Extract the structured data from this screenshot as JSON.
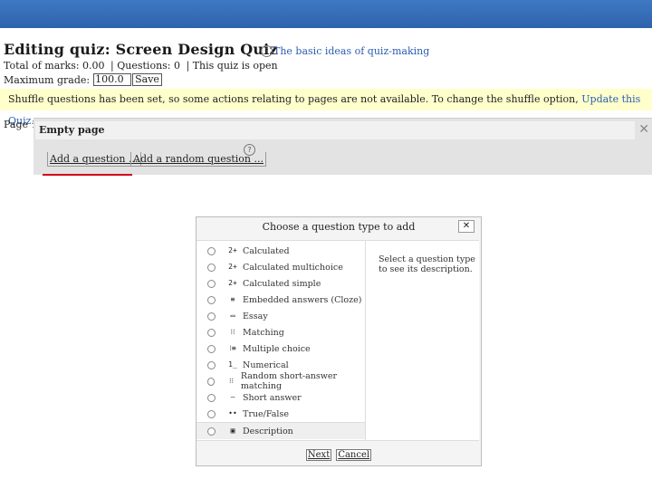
{
  "page": {
    "title": "Editing quiz: Screen Design Quiz",
    "help_link": "The basic ideas of quiz-making",
    "total_marks": "Total of marks: 0.00",
    "questions": "| Questions: 0",
    "quiz_status": "| This quiz is open",
    "max_grade_label": "Maximum grade:",
    "max_grade_value": "100.0",
    "save_label": "Save",
    "notice_text": "Shuffle questions has been set, so some actions relating to pages are not available. To change the shuffle option,",
    "notice_link": "Update this Quiz.",
    "page_label": "Page 1",
    "empty_page": "Empty page",
    "add_question": "Add a question ...",
    "add_random": "Add a random question ...",
    "close_glyph": "✕",
    "help_glyph": "?"
  },
  "dialog": {
    "title": "Choose a question type to add",
    "close_glyph": "✕",
    "question_types": [
      {
        "label": "Calculated",
        "icon": "calculated-icon",
        "glyph": "2+"
      },
      {
        "label": "Calculated multichoice",
        "icon": "calculated-multichoice-icon",
        "glyph": "2+"
      },
      {
        "label": "Calculated simple",
        "icon": "calculated-simple-icon",
        "glyph": "2+"
      },
      {
        "label": "Embedded answers (Cloze)",
        "icon": "cloze-icon",
        "glyph": "≡"
      },
      {
        "label": "Essay",
        "icon": "essay-icon",
        "glyph": "▭"
      },
      {
        "label": "Matching",
        "icon": "matching-icon",
        "glyph": "⁝⁝"
      },
      {
        "label": "Multiple choice",
        "icon": "multichoice-icon",
        "glyph": "⁝≡"
      },
      {
        "label": "Numerical",
        "icon": "numerical-icon",
        "glyph": "1̲"
      },
      {
        "label": "Random short-answer matching",
        "icon": "random-matching-icon",
        "glyph": "⁝⁝"
      },
      {
        "label": "Short answer",
        "icon": "short-answer-icon",
        "glyph": "—"
      },
      {
        "label": "True/False",
        "icon": "true-false-icon",
        "glyph": "••"
      }
    ],
    "description_item": {
      "label": "Description",
      "icon": "description-icon",
      "glyph": "▣"
    },
    "help_text": "Select a question type to see its description.",
    "next_label": "Next",
    "cancel_label": "Cancel"
  },
  "colors": {
    "topbar": "#2d63ab",
    "link": "#2a5db0",
    "notice_bg": "#ffffcc",
    "highlight": "#d0021b"
  }
}
